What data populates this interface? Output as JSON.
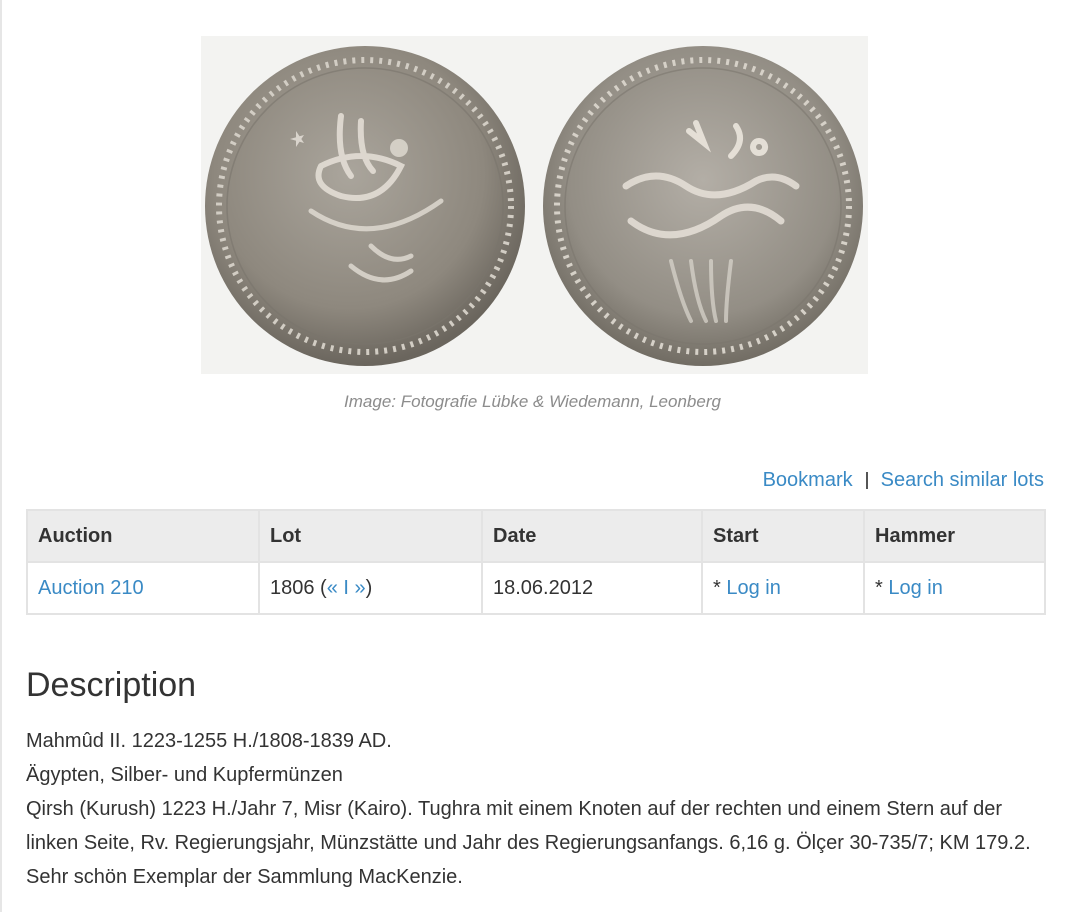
{
  "image": {
    "alt": "coin-obverse-and-reverse",
    "caption": "Image: Fotografie Lübke & Wiedemann, Leonberg"
  },
  "actions": {
    "bookmark": "Bookmark",
    "separator": "I",
    "search_similar": "Search similar lots"
  },
  "table": {
    "headers": [
      "Auction",
      "Lot",
      "Date",
      "Start",
      "Hammer"
    ],
    "row": {
      "auction": "Auction 210",
      "lot_number": "1806",
      "lot_open": " (",
      "prev": "«",
      "nav_sep": " I ",
      "next": "»",
      "lot_close": ")",
      "date": "18.06.2012",
      "start_prefix": "* ",
      "start_link": "Log in",
      "hammer_prefix": "* ",
      "hammer_link": "Log in"
    }
  },
  "description": {
    "title": "Description",
    "line1": "Mahmûd II. 1223-1255 H./1808-1839 AD.",
    "line2": "Ägypten, Silber- und Kupfermünzen",
    "line3": "Qirsh (Kurush) 1223 H./Jahr 7, Misr (Kairo). Tughra mit einem Knoten auf der rechten und einem Stern auf der linken Seite, Rv. Regierungsjahr, Münzstätte und Jahr des Regierungsanfangs. 6,16 g. Ölçer 30-735/7; KM 179.2. Sehr schön Exemplar der Sammlung MacKenzie."
  },
  "colors": {
    "link": "#3a8ac5",
    "header_bg": "#ececec",
    "coin_silver": "#9a958c"
  }
}
